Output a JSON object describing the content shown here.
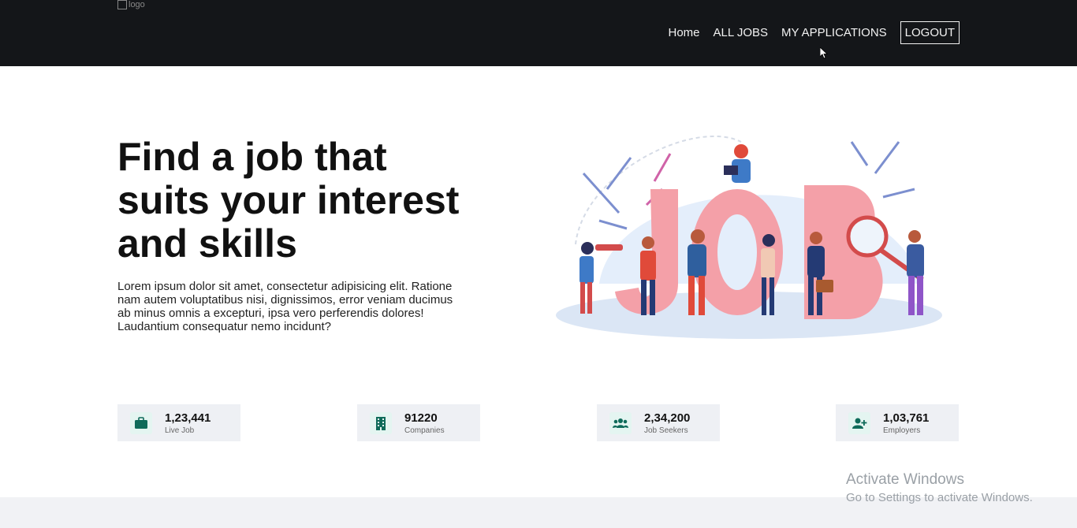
{
  "header": {
    "logo_alt": "logo",
    "nav": [
      "Home",
      "ALL JOBS",
      "MY APPLICATIONS"
    ],
    "logout_label": "LOGOUT"
  },
  "hero": {
    "title": "Find a job that suits your interest and skills",
    "text": "Lorem ipsum dolor sit amet, consectetur adipisicing elit. Ratione nam autem voluptatibus nisi, dignissimos, error veniam ducimus ab minus omnis a excepturi, ipsa vero perferendis dolores! Laudantium consequatur nemo incidunt?"
  },
  "stats": [
    {
      "value": "1,23,441",
      "label": "Live Job",
      "icon": "briefcase-icon"
    },
    {
      "value": "91220",
      "label": "Companies",
      "icon": "building-icon"
    },
    {
      "value": "2,34,200",
      "label": "Job Seekers",
      "icon": "users-icon"
    },
    {
      "value": "1,03,761",
      "label": "Employers",
      "icon": "add-user-icon"
    }
  ],
  "watermark": {
    "line1": "Activate Windows",
    "line2": "Go to Settings to activate Windows."
  },
  "colors": {
    "navbar": "#141619",
    "accent": "#0f6b5a",
    "stat_bg": "#eef0f4",
    "illustration_pink": "#f4a0a8"
  }
}
